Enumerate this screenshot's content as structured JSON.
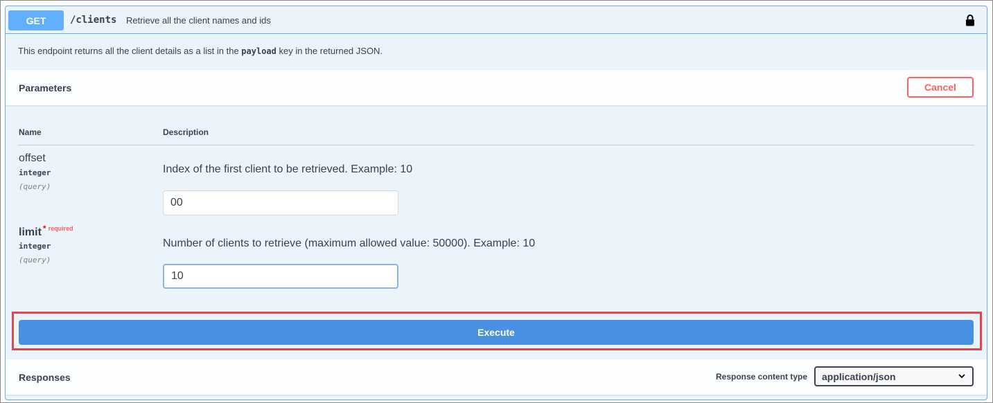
{
  "summary": {
    "method": "GET",
    "path": "/clients",
    "description": "Retrieve all the client names and ids"
  },
  "description": {
    "before": "This endpoint returns all the client details as a list in the ",
    "code": "payload",
    "after": " key in the returned JSON."
  },
  "parameters": {
    "title": "Parameters",
    "cancel_label": "Cancel",
    "col_name": "Name",
    "col_description": "Description",
    "items": [
      {
        "name": "offset",
        "type": "integer",
        "in": "(query)",
        "description": "Index of the first client to be retrieved. Example: 10",
        "value": "00",
        "required": false
      },
      {
        "name": "limit",
        "required_star": "*",
        "required_text": "required",
        "type": "integer",
        "in": "(query)",
        "description": "Number of clients to retrieve (maximum allowed value: 50000). Example: 10",
        "value": "10",
        "required": true
      }
    ]
  },
  "execute_label": "Execute",
  "responses": {
    "title": "Responses",
    "content_type_label": "Response content type",
    "content_type_value": "application/json"
  },
  "colors": {
    "get_method": "#61affe",
    "execute": "#4990e2",
    "cancel": "#ff6060",
    "highlight": "#e0474c"
  },
  "icons": {
    "lock": "lock-icon",
    "chevron": "chevron-down-icon"
  }
}
